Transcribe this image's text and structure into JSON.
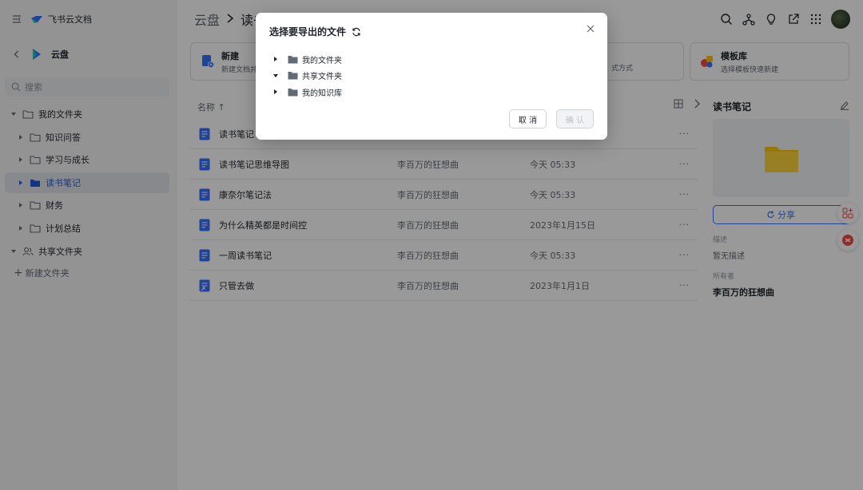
{
  "app": {
    "name": "飞书云文档"
  },
  "sidebar": {
    "nav_title": "云盘",
    "search_placeholder": "搜索",
    "tree": [
      {
        "label": "我的文件夹",
        "level": 0,
        "expanded": true,
        "icon": "folder-outline-icon"
      },
      {
        "label": "知识问答",
        "level": 1,
        "icon": "folder-outline-icon"
      },
      {
        "label": "学习与成长",
        "level": 1,
        "icon": "folder-outline-icon"
      },
      {
        "label": "读书笔记",
        "level": 1,
        "active": true,
        "icon": "folder-filled-icon"
      },
      {
        "label": "财务",
        "level": 1,
        "icon": "folder-outline-icon"
      },
      {
        "label": "计划总结",
        "level": 1,
        "icon": "folder-outline-icon"
      },
      {
        "label": "共享文件夹",
        "level": 0,
        "expanded": true,
        "icon": "shared-users-icon"
      }
    ],
    "add_folder": "新建文件夹"
  },
  "breadcrumb": {
    "root": "云盘",
    "current": "读书笔记"
  },
  "cards": {
    "new": {
      "title": "新建",
      "desc": "新建文档并"
    },
    "import_desc": "式方式",
    "templates": {
      "title": "模板库",
      "desc": "选择模板快速新建"
    }
  },
  "table": {
    "sort_label": "名称 ↑",
    "rows": [
      {
        "name": "读书笔记",
        "owner": "",
        "time": "",
        "icon": "doc-icon"
      },
      {
        "name": "读书笔记思维导图",
        "owner": "李百万的狂想曲",
        "time": "今天 05:33",
        "icon": "doc-icon"
      },
      {
        "name": "康奈尔笔记法",
        "owner": "李百万的狂想曲",
        "time": "今天 05:33",
        "icon": "doc-icon"
      },
      {
        "name": "为什么精英都是时间控",
        "owner": "李百万的狂想曲",
        "time": "2023年1月15日",
        "icon": "doc-icon"
      },
      {
        "name": "一周读书笔记",
        "owner": "李百万的狂想曲",
        "time": "今天 05:33",
        "icon": "doc-icon"
      },
      {
        "name": "只管去做",
        "owner": "李百万的狂想曲",
        "time": "2023年1月1日",
        "icon": "doc-shortcut-icon"
      }
    ],
    "more_label": "···"
  },
  "detail": {
    "title": "读书笔记",
    "share_label": "分享",
    "desc_label": "描述",
    "desc_value": "暂无描述",
    "owner_label": "所有者",
    "owner_value": "李百万的狂想曲"
  },
  "dialog": {
    "title": "选择要导出的文件",
    "items": [
      {
        "label": "我的文件夹",
        "expanded": false
      },
      {
        "label": "共享文件夹",
        "expanded": true
      },
      {
        "label": "我的知识库",
        "expanded": false
      }
    ],
    "cancel_label": "取 消",
    "confirm_label": "确 认"
  },
  "colors": {
    "accent": "#3370ff",
    "active_text": "#245bdb",
    "overlay": "rgba(0,0,0,0.4)"
  }
}
